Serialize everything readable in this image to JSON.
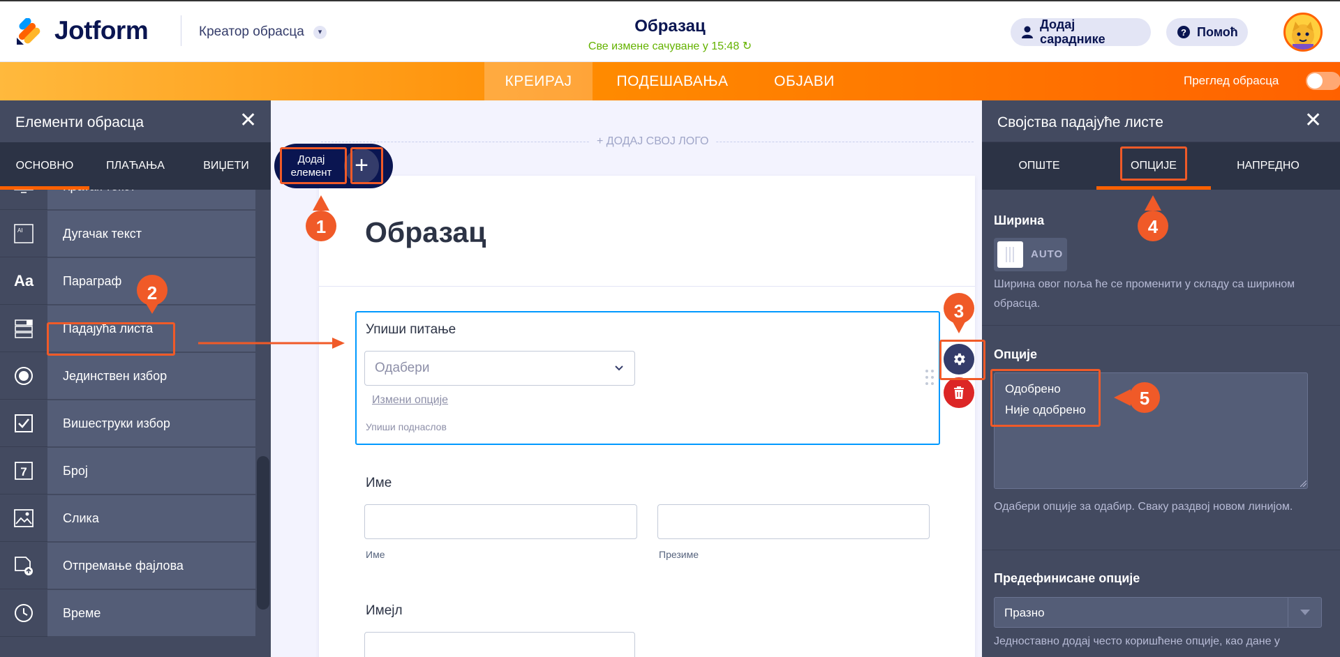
{
  "header": {
    "logo_text": "Jotform",
    "builder_label": "Креатор обрасца",
    "form_title": "Образац",
    "saved_status": "Све измене сачуване у 15:48",
    "add_collaborators": "Додај сараднике",
    "help": "Помоћ"
  },
  "nav": {
    "tabs": [
      "КРЕИРАЈ",
      "ПОДЕШАВАЊА",
      "ОБЈАВИ"
    ],
    "preview_label": "Преглед обрасца"
  },
  "left_panel": {
    "title": "Елементи обрасца",
    "tabs": [
      "ОСНОВНО",
      "ПЛАЋАЊА",
      "ВИЏЕТИ"
    ],
    "items": [
      {
        "label": "Кратак текст",
        "icon": "short-text-icon"
      },
      {
        "label": "Дугачак текст",
        "icon": "long-text-icon"
      },
      {
        "label": "Параграф",
        "icon": "paragraph-icon"
      },
      {
        "label": "Падајућа листа",
        "icon": "dropdown-icon"
      },
      {
        "label": "Јединствен избор",
        "icon": "radio-icon"
      },
      {
        "label": "Вишеструки избор",
        "icon": "checkbox-icon"
      },
      {
        "label": "Број",
        "icon": "number-icon"
      },
      {
        "label": "Слика",
        "icon": "image-icon"
      },
      {
        "label": "Отпремање фајлова",
        "icon": "file-upload-icon"
      },
      {
        "label": "Време",
        "icon": "clock-icon"
      }
    ]
  },
  "canvas": {
    "add_logo": "+ ДОДАЈ СВОЈ ЛОГО",
    "add_element_label": "Додај елемент",
    "form_heading": "Образац",
    "question": {
      "label": "Упиши питање",
      "placeholder": "Одабери",
      "edit_options": "Измени опције",
      "subtitle": "Упиши поднаслов"
    },
    "name_field": {
      "label": "Име",
      "first_sub": "Име",
      "last_sub": "Презиме"
    },
    "email_field": {
      "label": "Имејл"
    }
  },
  "right_panel": {
    "title": "Својства падајуће листе",
    "tabs": [
      "ОПШТЕ",
      "ОПЦИЈЕ",
      "НАПРЕДНО"
    ],
    "width_title": "Ширина",
    "width_value": "AUTO",
    "width_desc": "Ширина овог поља ће се променити у складу са ширином обрасца.",
    "options_title": "Опције",
    "options": [
      "Одобрено",
      "Није одобрено"
    ],
    "options_desc": "Одабери опције за одабир. Сваку раздвој новом линијом.",
    "predefined_title": "Предефинисане опције",
    "predefined_value": "Празно",
    "predefined_desc": "Једноставно додај често коришћене опције, као дане у"
  },
  "annotations": [
    "1",
    "2",
    "3",
    "4",
    "5"
  ],
  "colors": {
    "accent": "#ff6100",
    "annotation": "#f05a28",
    "panel": "#434a60",
    "selected_border": "#0099ff"
  }
}
